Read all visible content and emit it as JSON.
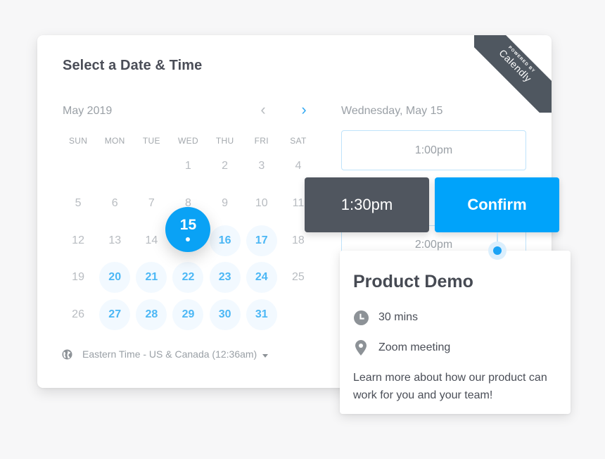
{
  "header": {
    "title": "Select a Date & Time"
  },
  "branding": {
    "powered_by": "POWERED BY",
    "brand": "Calendly"
  },
  "calendar": {
    "month_label": "May 2019",
    "prev_icon": "chevron-left-icon",
    "next_icon": "chevron-right-icon",
    "prev_glyph": "‹",
    "next_glyph": "›",
    "weekdays": [
      "SUN",
      "MON",
      "TUE",
      "WED",
      "THU",
      "FRI",
      "SAT"
    ],
    "selected_day": "15",
    "weeks": [
      [
        {
          "d": ""
        },
        {
          "d": ""
        },
        {
          "d": ""
        },
        {
          "d": "1"
        },
        {
          "d": "2"
        },
        {
          "d": "3"
        },
        {
          "d": "4"
        }
      ],
      [
        {
          "d": "5"
        },
        {
          "d": "6"
        },
        {
          "d": "7"
        },
        {
          "d": "8"
        },
        {
          "d": "9"
        },
        {
          "d": "10"
        },
        {
          "d": "11"
        }
      ],
      [
        {
          "d": "12"
        },
        {
          "d": "13"
        },
        {
          "d": "14"
        },
        {
          "d": "15",
          "state": "selected"
        },
        {
          "d": "16",
          "state": "available"
        },
        {
          "d": "17",
          "state": "available"
        },
        {
          "d": "18"
        }
      ],
      [
        {
          "d": "19"
        },
        {
          "d": "20",
          "state": "available"
        },
        {
          "d": "21",
          "state": "available"
        },
        {
          "d": "22",
          "state": "available"
        },
        {
          "d": "23",
          "state": "available"
        },
        {
          "d": "24",
          "state": "available"
        },
        {
          "d": "25"
        }
      ],
      [
        {
          "d": "26"
        },
        {
          "d": "27",
          "state": "available"
        },
        {
          "d": "28",
          "state": "available"
        },
        {
          "d": "29",
          "state": "available"
        },
        {
          "d": "30",
          "state": "available"
        },
        {
          "d": "31",
          "state": "available"
        },
        {
          "d": ""
        }
      ]
    ],
    "timezone": "Eastern Time - US & Canada (12:36am)"
  },
  "times": {
    "date_heading": "Wednesday, May 15",
    "slots": [
      "1:00pm",
      "2:00pm"
    ],
    "selected_time": "1:30pm",
    "confirm_label": "Confirm"
  },
  "event": {
    "title": "Product Demo",
    "duration": "30 mins",
    "location": "Zoom meeting",
    "description": "Learn more about how our product can work for you and your team!"
  },
  "colors": {
    "accent": "#00a3fa",
    "dark": "#50565f",
    "available_text": "#4bb7f5",
    "available_bg": "#f2f9ff"
  }
}
